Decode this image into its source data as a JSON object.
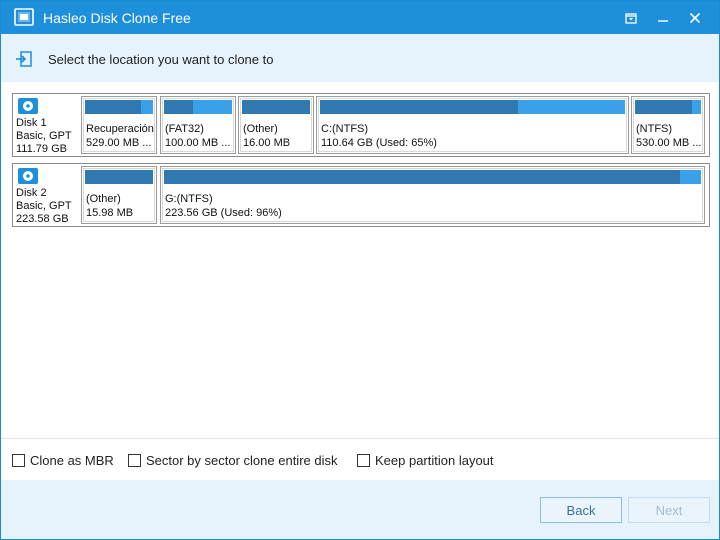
{
  "window": {
    "title": "Hasleo Disk Clone Free",
    "accent": "#1d8fdb"
  },
  "header": {
    "instruction": "Select the location you want to clone to"
  },
  "disks": [
    {
      "lines": [
        "Disk 1",
        "Basic, GPT",
        "111.79 GB"
      ],
      "partitions": [
        {
          "name": "Recuperación",
          "size": "529.00 MB ...",
          "used_fraction": 0.82
        },
        {
          "name": "(FAT32)",
          "size": "100.00 MB ...",
          "used_fraction": 0.43
        },
        {
          "name": "(Other)",
          "size": "16.00 MB",
          "used_fraction": 1.0
        },
        {
          "name": "C:(NTFS)",
          "size": "110.64 GB (Used: 65%)",
          "used_fraction": 0.65
        },
        {
          "name": "(NTFS)",
          "size": "530.00 MB ...",
          "used_fraction": 0.87
        }
      ]
    },
    {
      "lines": [
        "Disk 2",
        "Basic, GPT",
        "223.58 GB"
      ],
      "partitions": [
        {
          "name": "(Other)",
          "size": "15.98 MB",
          "used_fraction": 1.0
        },
        {
          "name": "G:(NTFS)",
          "size": "223.56 GB (Used: 96%)",
          "used_fraction": 0.96
        }
      ]
    }
  ],
  "options": {
    "clone_as_mbr": "Clone as MBR",
    "sector_by_sector": "Sector by sector clone entire disk",
    "keep_layout": "Keep partition layout"
  },
  "footer": {
    "back": "Back",
    "next": "Next"
  }
}
